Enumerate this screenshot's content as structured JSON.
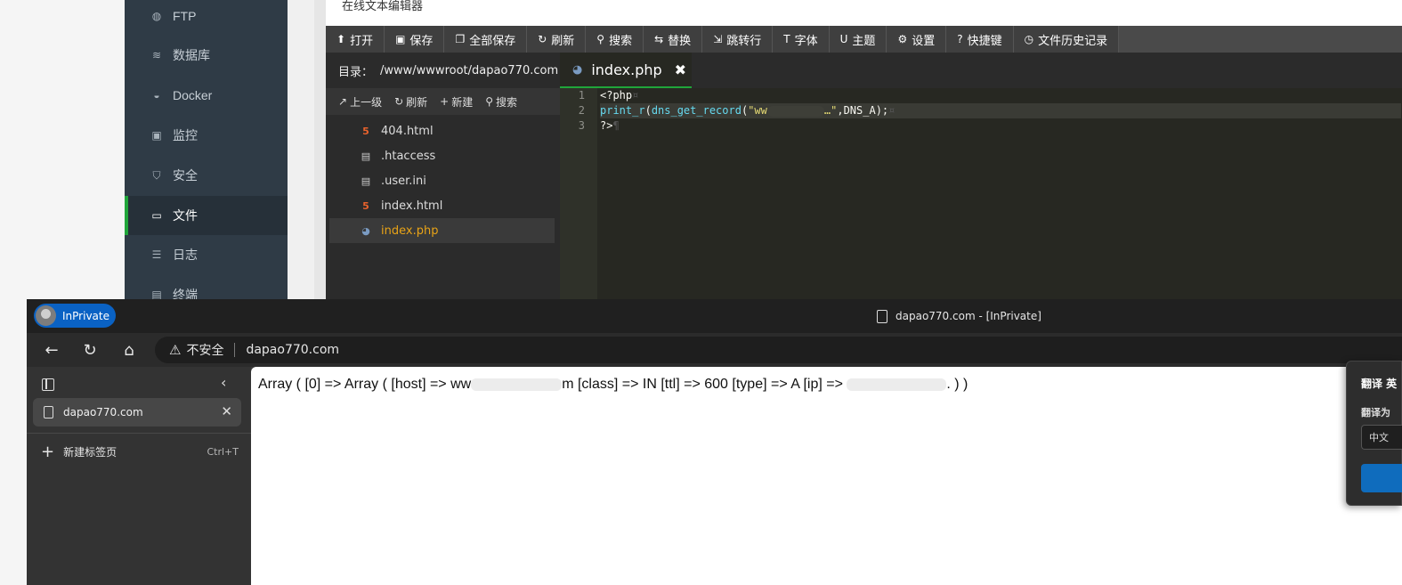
{
  "sidebar": {
    "items": [
      {
        "label": "FTP",
        "icon": "globe-icon",
        "active": false
      },
      {
        "label": "数据库",
        "icon": "database-icon",
        "active": false
      },
      {
        "label": "Docker",
        "icon": "docker-icon",
        "active": false
      },
      {
        "label": "监控",
        "icon": "monitor-icon",
        "active": false
      },
      {
        "label": "安全",
        "icon": "shield-icon",
        "active": false
      },
      {
        "label": "文件",
        "icon": "folder-icon",
        "active": true
      },
      {
        "label": "日志",
        "icon": "log-icon",
        "active": false
      },
      {
        "label": "终端",
        "icon": "terminal-icon",
        "active": false
      }
    ]
  },
  "editor": {
    "title": "在线文本编辑器",
    "toolbar": [
      {
        "label": "打开",
        "glyph": "⬆",
        "icon": "upload-icon"
      },
      {
        "label": "保存",
        "glyph": "▣",
        "icon": "save-icon"
      },
      {
        "label": "全部保存",
        "glyph": "❐",
        "icon": "save-all-icon"
      },
      {
        "label": "刷新",
        "glyph": "↻",
        "icon": "refresh-icon"
      },
      {
        "label": "搜索",
        "glyph": "⚲",
        "icon": "search-icon"
      },
      {
        "label": "替换",
        "glyph": "⇆",
        "icon": "replace-icon"
      },
      {
        "label": "跳转行",
        "glyph": "⇲",
        "icon": "goto-line-icon"
      },
      {
        "label": "字体",
        "glyph": "T",
        "icon": "font-icon"
      },
      {
        "label": "主题",
        "glyph": "U",
        "icon": "theme-icon"
      },
      {
        "label": "设置",
        "glyph": "⚙",
        "icon": "gear-icon"
      },
      {
        "label": "快捷键",
        "glyph": "?",
        "icon": "help-icon"
      },
      {
        "label": "文件历史记录",
        "glyph": "◷",
        "icon": "history-icon"
      }
    ],
    "dir_label": "目录：",
    "dir_path": "/www/wwwroot/dapao770.com",
    "file_tools": [
      {
        "label": "上一级",
        "glyph": "↗",
        "icon": "up-level-icon"
      },
      {
        "label": "刷新",
        "glyph": "↻",
        "icon": "refresh-icon"
      },
      {
        "label": "新建",
        "glyph": "+",
        "icon": "plus-icon"
      },
      {
        "label": "搜索",
        "glyph": "⚲",
        "icon": "search-icon"
      }
    ],
    "files": [
      {
        "name": "404.html",
        "type": "html",
        "selected": false
      },
      {
        "name": ".htaccess",
        "type": "doc",
        "selected": false
      },
      {
        "name": ".user.ini",
        "type": "doc",
        "selected": false
      },
      {
        "name": "index.html",
        "type": "html",
        "selected": false
      },
      {
        "name": "index.php",
        "type": "php",
        "selected": true
      }
    ],
    "active_tab": "index.php",
    "line_numbers": [
      "1",
      "2",
      "3"
    ],
    "code": {
      "line1": "<?php",
      "line2_func1": "print_r",
      "line2_func2": "dns_get_record",
      "line2_str_start": "\"ww",
      "line2_str_end": "…\"",
      "line2_arg": ",DNS_A",
      "line2_end": ");",
      "line3": "?>"
    }
  },
  "browser": {
    "badge": "InPrivate",
    "window_title": "dapao770.com - [InPrivate]",
    "security": "不安全",
    "url": "dapao770.com",
    "tab_title": "dapao770.com",
    "new_tab": "新建标签页",
    "new_tab_shortcut": "Ctrl+T",
    "page": {
      "part1": "Array ( [0] => Array ( [host] => ww",
      "part2": "m [class] => IN [ttl] => 600 [type] => A [ip] => ",
      "part3": ". ) )"
    }
  },
  "translate_popup": {
    "title": "翻译 英",
    "target_label": "翻译为",
    "target_value": "中文"
  }
}
